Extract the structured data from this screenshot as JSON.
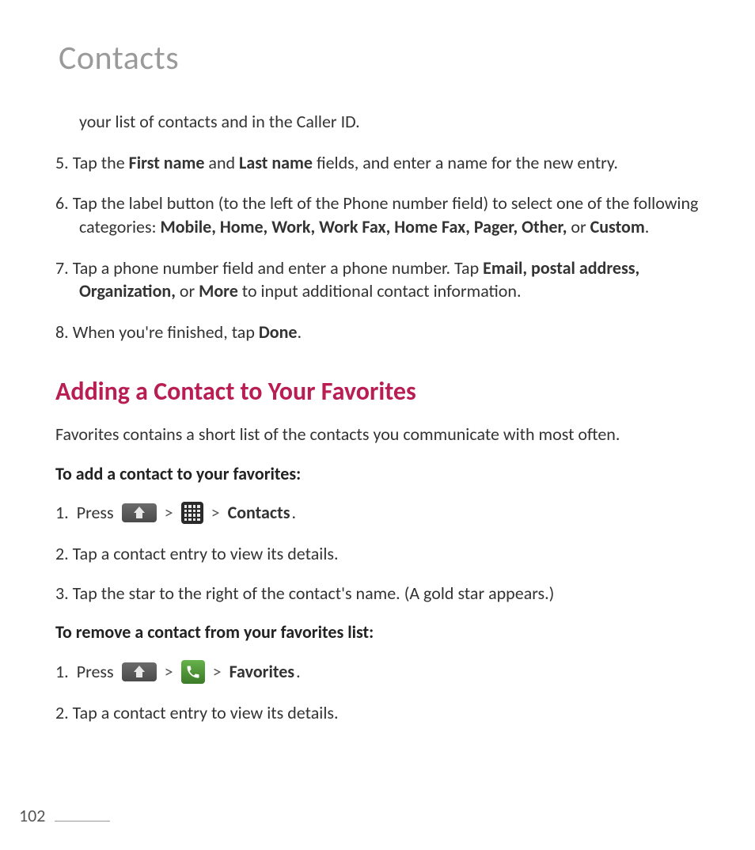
{
  "chapter_title": "Contacts",
  "continuation_line": "your list of contacts and in the Caller ID.",
  "item5": {
    "num": "5. ",
    "pre": "Tap the ",
    "b1": "First name",
    "mid1": " and ",
    "b2": "Last name",
    "post": " fields, and enter a name for the new entry."
  },
  "item6": {
    "num": "6. ",
    "pre": "Tap the label button (to the left of the Phone number field) to select one of the following categories: ",
    "b1": "Mobile, Home, Work, Work Fax, Home Fax, Pager, Other,",
    "mid": " or ",
    "b2": "Custom",
    "post": "."
  },
  "item7": {
    "num": "7.  ",
    "pre": "Tap a phone number field and enter a phone number. Tap ",
    "b1": "Email, postal address, Organization,",
    "mid": " or ",
    "b2": "More",
    "post": " to input additional contact information."
  },
  "item8": {
    "num": "8. ",
    "pre": "When you're finished, tap ",
    "b1": "Done",
    "post": "."
  },
  "section_title": "Adding a Contact to Your Favorites",
  "fav_intro": "Favorites contains a short list of the contacts you communicate with most often.",
  "fav_add_heading": "To add a contact to your favorites:",
  "fav_add": {
    "s1_num": "1.",
    "s1_press": "Press",
    "gt": ">",
    "s1_contacts": "Contacts",
    "s1_dot": ".",
    "s2": "2. Tap a contact entry to view its details.",
    "s3": "3. Tap the star to the right of the contact's name. (A gold star appears.)"
  },
  "fav_remove_heading": "To remove a contact from your favorites list:",
  "fav_remove": {
    "s1_num": "1.",
    "s1_press": "Press",
    "gt": ">",
    "s1_fav": "Favorites",
    "s1_dot": ".",
    "s2": "2. Tap a contact entry to view its details."
  },
  "page_number": "102"
}
